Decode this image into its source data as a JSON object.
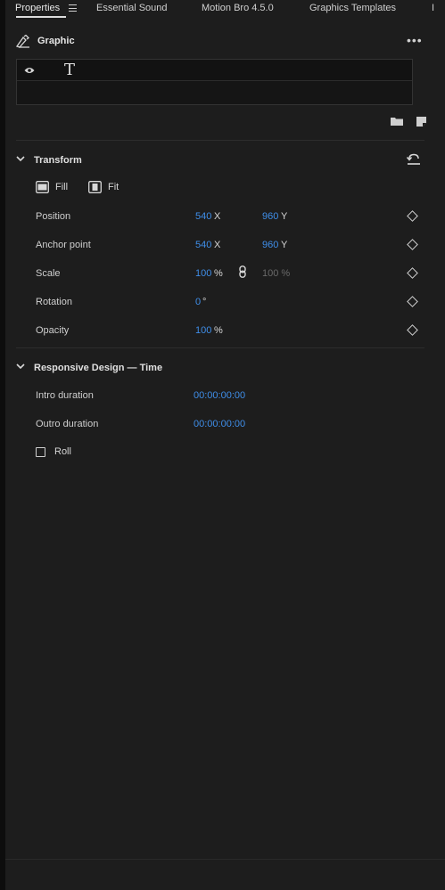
{
  "tabs": [
    {
      "label": "Properties"
    },
    {
      "label": "Essential Sound"
    },
    {
      "label": "Motion Bro 4.5.0"
    },
    {
      "label": "Graphics Templates"
    },
    {
      "label": "I"
    }
  ],
  "graphic": {
    "label": "Graphic"
  },
  "layers": {
    "text_layer_icon": "T"
  },
  "transform": {
    "title": "Transform",
    "fill_label": "Fill",
    "fit_label": "Fit",
    "position": {
      "label": "Position",
      "x": "540",
      "x_unit": "X",
      "y": "960",
      "y_unit": "Y"
    },
    "anchor": {
      "label": "Anchor point",
      "x": "540",
      "x_unit": "X",
      "y": "960",
      "y_unit": "Y"
    },
    "scale": {
      "label": "Scale",
      "value": "100",
      "unit": "%",
      "linked_value": "100 %"
    },
    "rotation": {
      "label": "Rotation",
      "value": "0",
      "unit": "°"
    },
    "opacity": {
      "label": "Opacity",
      "value": "100",
      "unit": "%"
    }
  },
  "responsive": {
    "title": "Responsive Design — Time",
    "intro": {
      "label": "Intro duration",
      "value": "00:00:00:00"
    },
    "outro": {
      "label": "Outro duration",
      "value": "00:00:00:00"
    },
    "roll_label": "Roll",
    "roll_checked": false
  },
  "colors": {
    "accent": "#3f8ee9",
    "background": "#1d1d1d"
  }
}
